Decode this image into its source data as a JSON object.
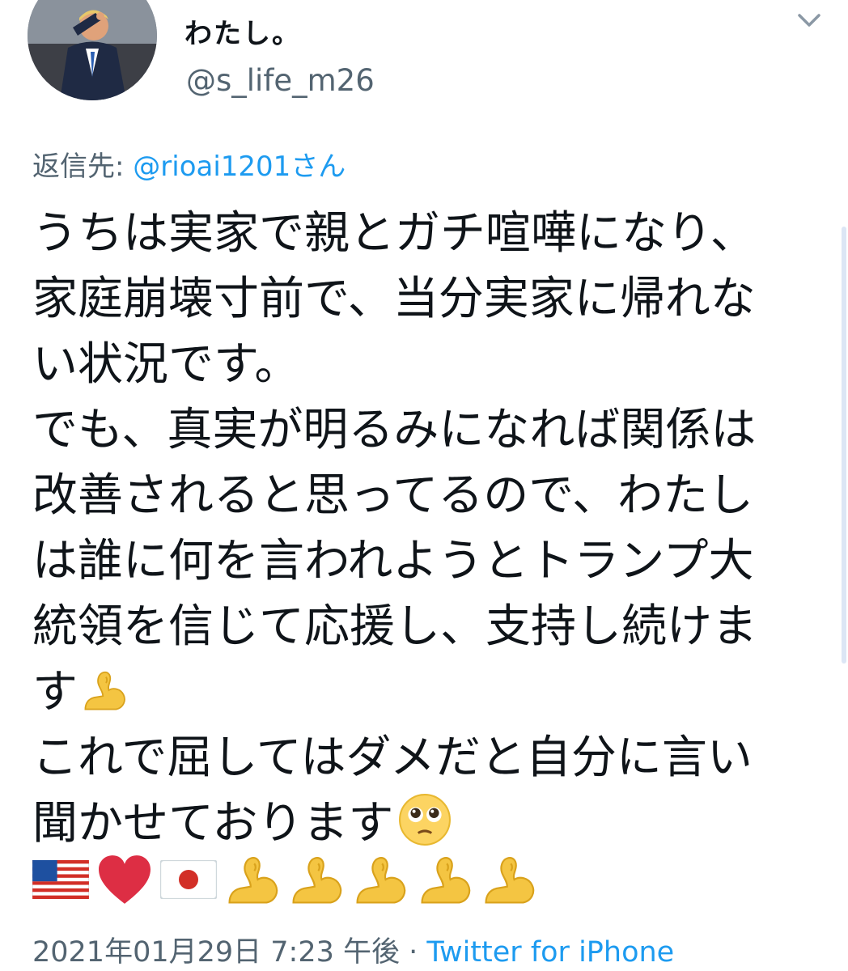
{
  "author": {
    "display_name": "わたし。",
    "handle": "@s_life_m26",
    "avatar_icon": "profile-photo"
  },
  "menu_icon": "chevron-down-icon",
  "reply": {
    "prefix": "返信先: ",
    "mention": "@rioai1201",
    "suffix": "さん"
  },
  "body": {
    "lines": [
      "うちは実家で親とガチ喧嘩になり、",
      "家庭崩壊寸前で、当分実家に帰れな",
      "い状況です。",
      "でも、真実が明るみになれば関係は",
      "改善されると思ってるので、わたし",
      "は誰に何を言われようとトランプ大",
      "統領を信じて応援し、支持し続けま",
      "す",
      "これで屈してはダメだと自分に言い",
      "聞かせております"
    ],
    "line8_emoji": "flexed-biceps",
    "line10_emoji": "pleading-face"
  },
  "emoji_row": [
    "us-flag",
    "red-heart",
    "japan-flag",
    "flexed-biceps",
    "flexed-biceps",
    "flexed-biceps",
    "flexed-biceps",
    "flexed-biceps"
  ],
  "meta": {
    "timestamp": "2021年01月29日 7:23 午後",
    "separator": " · ",
    "source": "Twitter for iPhone"
  },
  "colors": {
    "text": "#0f1419",
    "secondary": "#536471",
    "link": "#1d9bf0"
  }
}
